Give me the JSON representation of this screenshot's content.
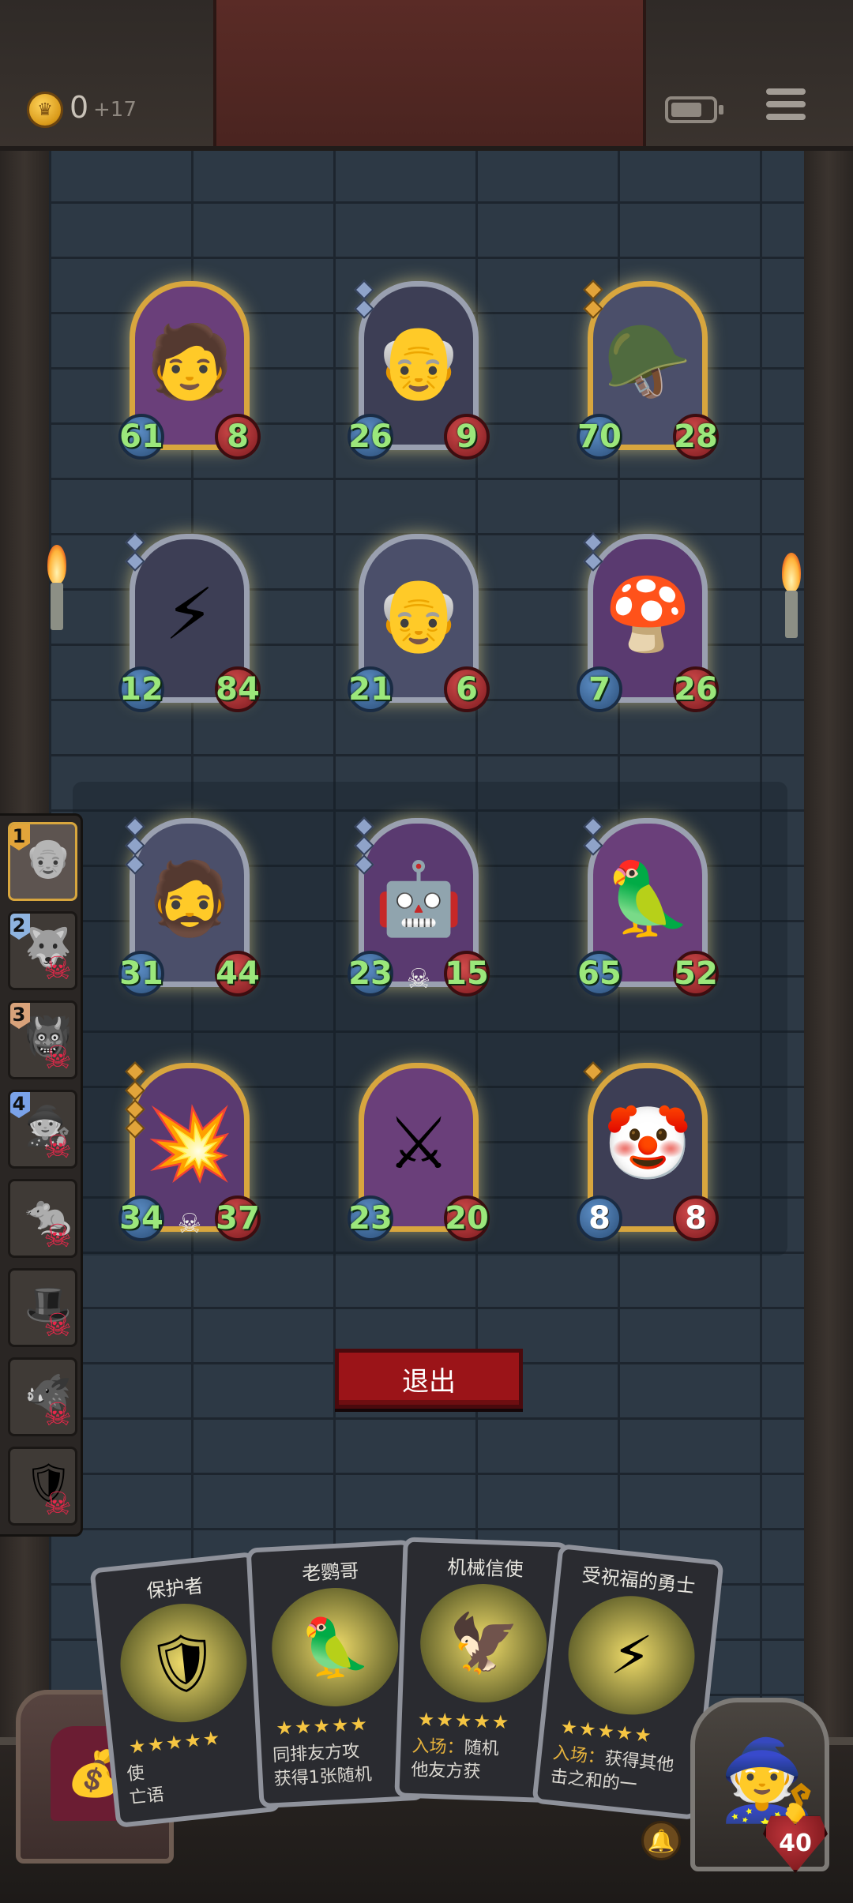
{
  "header": {
    "gold": "0",
    "gold_income": "+17"
  },
  "board": {
    "rows": [
      [
        {
          "attack": "61",
          "health": "8",
          "icon": "knight-portrait-icon",
          "emoji": "🧑",
          "frame": "gold",
          "pips": 0
        },
        {
          "attack": "26",
          "health": "9",
          "icon": "old-man-portrait-icon",
          "emoji": "👴",
          "frame": "silver",
          "pips": 2
        },
        {
          "attack": "70",
          "health": "28",
          "icon": "soldier-portrait-icon",
          "emoji": "🪖",
          "frame": "gold",
          "pips": 2
        }
      ],
      [
        {
          "attack": "12",
          "health": "84",
          "icon": "blessed-champion-portrait-icon",
          "emoji": "⚡",
          "frame": "silver",
          "pips": 2
        },
        {
          "attack": "21",
          "health": "6",
          "icon": "old-man-portrait-icon",
          "emoji": "👴",
          "frame": "silver",
          "pips": 0
        },
        {
          "attack": "7",
          "health": "26",
          "icon": "mushroom-portrait-icon",
          "emoji": "🍄",
          "frame": "silver",
          "pips": 2
        }
      ],
      [
        {
          "attack": "31",
          "health": "44",
          "icon": "dwarf-portrait-icon",
          "emoji": "🧔",
          "frame": "silver",
          "pips": 3
        },
        {
          "attack": "23",
          "health": "15",
          "icon": "robot-portrait-icon",
          "emoji": "🤖",
          "frame": "silver",
          "pips": 3,
          "skull": true
        },
        {
          "attack": "65",
          "health": "52",
          "icon": "parrot-portrait-icon",
          "emoji": "🦜",
          "frame": "silver",
          "pips": 2
        }
      ],
      [
        {
          "attack": "34",
          "health": "37",
          "icon": "cannon-portrait-icon",
          "emoji": "💥",
          "frame": "gold",
          "pips": 4,
          "skull": true
        },
        {
          "attack": "23",
          "health": "20",
          "icon": "armored-knight-portrait-icon",
          "emoji": "⚔",
          "frame": "gold",
          "pips": 0
        },
        {
          "attack": "8",
          "health": "8",
          "icon": "jester-portrait-icon",
          "emoji": "🤡",
          "frame": "gold",
          "pips": 1,
          "whiteStats": true
        }
      ]
    ]
  },
  "warband": {
    "slots": [
      {
        "rank": "1",
        "rank_color": "#e2a43a",
        "active": true,
        "emoji": "👴"
      },
      {
        "rank": "2",
        "rank_color": "#8fb4e0",
        "dead": true,
        "emoji": "🐺"
      },
      {
        "rank": "3",
        "rank_color": "#d8a27a",
        "dead": true,
        "emoji": "👹"
      },
      {
        "rank": "4",
        "rank_color": "#7aa2e8",
        "dead": true,
        "emoji": "🧙"
      },
      {
        "rank": "",
        "dead": true,
        "emoji": "🐀"
      },
      {
        "rank": "",
        "dead": true,
        "emoji": "🎩"
      },
      {
        "rank": "",
        "dead": true,
        "emoji": "🐗"
      },
      {
        "rank": "",
        "dead": true,
        "emoji": "🛡"
      }
    ]
  },
  "exit_button": "退出",
  "hand": [
    {
      "title": "保护者",
      "emoji": "🛡",
      "desc_kw": "",
      "desc": "使",
      "desc2": "亡语"
    },
    {
      "title": "老鹦哥",
      "emoji": "🦜",
      "desc_kw": "",
      "desc": "同排友方攻",
      "desc2": "获得1张随机"
    },
    {
      "title": "机械信使",
      "emoji": "🦅",
      "desc_kw": "入场：",
      "desc": "随机",
      "desc2": "他友方获"
    },
    {
      "title": "受祝福的勇士",
      "emoji": "⚡",
      "desc_kw": "入场：",
      "desc": "获得其他",
      "desc2": "击之和的一"
    }
  ],
  "hero": {
    "health": "40"
  },
  "colors": {
    "wall": "#2d3945",
    "attack_text": "#9be77b",
    "exit_button": "#9b1418"
  }
}
